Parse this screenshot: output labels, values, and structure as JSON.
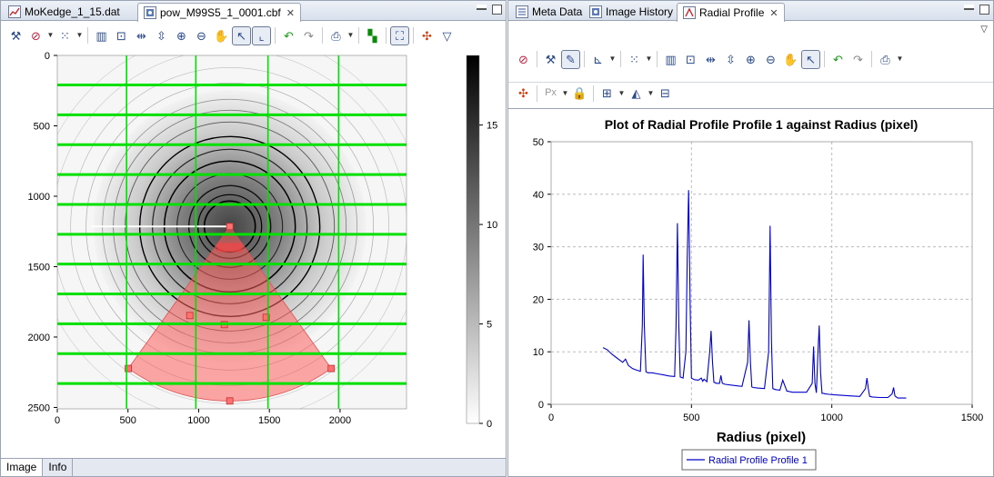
{
  "left": {
    "tabs": [
      {
        "label": "MoKedge_1_15.dat",
        "icon": "line-plot-icon",
        "closable": false
      },
      {
        "label": "pow_M99S5_1_0001.cbf",
        "icon": "image-file-icon",
        "closable": true
      }
    ],
    "toolbar": [
      "settings-icon",
      "clear-plot-icon",
      "dd",
      "scatter-tool-icon",
      "dd",
      "sep",
      "bin-image-icon",
      "zoom-box-icon",
      "x-range-icon",
      "y-range-icon",
      "zoom-in-icon",
      "zoom-out-icon",
      "pan-icon",
      "pointer-icon",
      "origin-icon",
      "sep",
      "undo-icon",
      "redo-icon",
      "sep",
      "print-icon",
      "dd",
      "sep",
      "color-map-icon",
      "sep",
      "fit-icon",
      "sep",
      "tools-icon",
      "view-menu-icon"
    ],
    "bottom_tabs": [
      "Image",
      "Info"
    ],
    "image": {
      "x_ticks": [
        "0",
        "500",
        "1000",
        "1500",
        "2000"
      ],
      "y_ticks": [
        "0",
        "500",
        "1000",
        "1500",
        "2000",
        "2500"
      ],
      "colorbar_ticks": [
        "0",
        "5",
        "10",
        "15"
      ],
      "grid_color": "#00e000",
      "sector_color": "#ff6060"
    }
  },
  "right": {
    "tabs": [
      {
        "label": "Meta Data",
        "icon": "metadata-icon",
        "closable": false
      },
      {
        "label": "Image History",
        "icon": "image-history-icon",
        "closable": false
      },
      {
        "label": "Radial Profile",
        "icon": "radial-profile-icon",
        "closable": true
      }
    ],
    "toolbar1": [
      "clear-plot-icon",
      "sep",
      "settings-icon",
      "brush-icon",
      "sep",
      "axis-config-icon",
      "dd",
      "sep",
      "scatter-tool-icon",
      "dd",
      "sep",
      "bin-image-icon",
      "zoom-box-icon",
      "x-range-icon",
      "y-range-icon",
      "zoom-in-icon",
      "zoom-out-icon",
      "pan-icon",
      "pointer-icon",
      "sep",
      "undo-icon",
      "redo-icon",
      "sep",
      "print-icon",
      "dd"
    ],
    "toolbar2": [
      "tools-icon",
      "sep",
      "pixel-units-icon",
      "dd",
      "lock-icon",
      "sep",
      "add-profile-icon",
      "dd",
      "region-icon",
      "dd",
      "remove-profile-icon"
    ],
    "pixel_units_label": "Px",
    "legend_label": "Radial Profile Profile 1"
  },
  "chart_data": {
    "type": "line",
    "title": "Plot of Radial Profile Profile 1 against Radius (pixel)",
    "xlabel": "Radius (pixel)",
    "ylabel": "",
    "xlim": [
      0,
      1500
    ],
    "ylim": [
      0,
      50
    ],
    "x_ticks": [
      "0",
      "500",
      "1000",
      "1500"
    ],
    "y_ticks": [
      "0",
      "10",
      "20",
      "30",
      "40",
      "50"
    ],
    "grid": true,
    "legend": "bottom-center",
    "series": [
      {
        "name": "Radial Profile Profile 1",
        "color": "#0000cc",
        "x": [
          185,
          200,
          215,
          230,
          245,
          255,
          265,
          275,
          290,
          305,
          318,
          325,
          328,
          332,
          338,
          345,
          360,
          380,
          400,
          420,
          440,
          445,
          450,
          455,
          460,
          470,
          480,
          485,
          490,
          495,
          500,
          510,
          525,
          535,
          540,
          545,
          555,
          565,
          570,
          575,
          580,
          590,
          600,
          605,
          610,
          620,
          650,
          680,
          700,
          705,
          710,
          715,
          720,
          735,
          760,
          775,
          780,
          785,
          790,
          800,
          815,
          825,
          840,
          845,
          850,
          860,
          890,
          910,
          930,
          935,
          940,
          945,
          950,
          955,
          960,
          965,
          970,
          975,
          990,
          1010,
          1040,
          1070,
          1100,
          1120,
          1125,
          1130,
          1135,
          1145,
          1170,
          1200,
          1215,
          1220,
          1225,
          1235,
          1265
        ],
        "y": [
          10.8,
          10.4,
          9.6,
          9.0,
          8.4,
          8.0,
          8.6,
          7.4,
          6.8,
          6.5,
          6.3,
          15,
          28.5,
          15,
          6.2,
          6.0,
          6.0,
          5.8,
          5.6,
          5.4,
          5.3,
          15,
          34.5,
          15,
          5.2,
          5.0,
          10,
          28,
          40.8,
          20,
          5.0,
          4.7,
          4.6,
          5.0,
          4.4,
          4.8,
          4.3,
          10,
          14,
          8,
          4.2,
          4.0,
          4.0,
          5.5,
          4.0,
          3.8,
          3.6,
          3.4,
          8,
          16,
          8,
          3.3,
          3.2,
          3.1,
          3.0,
          10,
          34,
          12,
          3.0,
          2.8,
          2.7,
          4.6,
          2.5,
          2.5,
          2.4,
          2.3,
          2.3,
          2.3,
          4,
          11,
          4,
          2.2,
          9,
          15,
          6,
          2.1,
          2.1,
          2.0,
          1.9,
          1.8,
          1.7,
          1.6,
          1.5,
          3,
          5,
          3,
          1.5,
          1.4,
          1.3,
          1.3,
          2,
          3.2,
          1.6,
          1.2,
          1.2
        ]
      }
    ]
  }
}
